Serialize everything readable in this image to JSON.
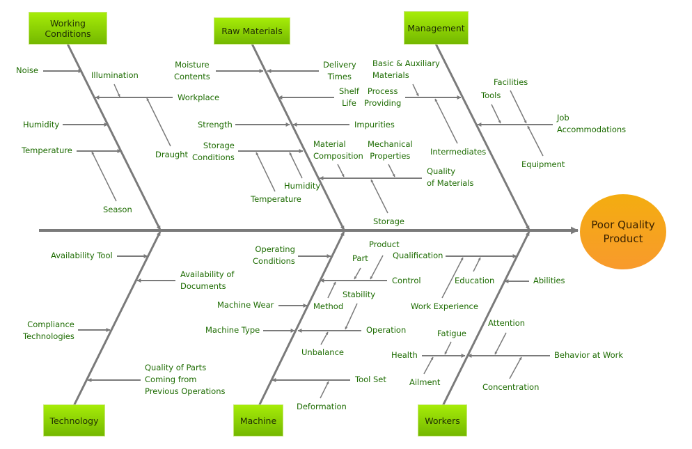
{
  "diagram": {
    "type": "fishbone",
    "effect": "Poor Quality\nProduct",
    "colors": {
      "bone": "#7a7a7a",
      "label_text": "#1c6b00",
      "category_fill_top": "#a6ec08",
      "category_fill_bottom": "#74b800",
      "effect_fill_top": "#f4ad10",
      "effect_fill_bottom": "#f89a2c"
    },
    "categories": {
      "working_conditions": {
        "title": "Working\nConditions",
        "causes": {
          "noise": "Noise",
          "illumination": "Illumination",
          "workplace": "Workplace",
          "humidity": "Humidity",
          "draught": "Draught",
          "temperature": "Temperature",
          "season": "Season"
        }
      },
      "raw_materials": {
        "title": "Raw Materials",
        "causes": {
          "moisture_contents": "Moisture\nContents",
          "delivery_times": "Delivery\nTimes",
          "shelf_life": "Shelf\nLife",
          "strength": "Strength",
          "impurities": "Impurities",
          "storage_conditions": "Storage\nConditions",
          "humidity": "Humidity",
          "temperature": "Temperature",
          "material_composition": "Material\nComposition",
          "mechanical_properties": "Mechanical\nProperties",
          "quality_of_materials": "Quality\nof Materials",
          "storage": "Storage"
        }
      },
      "management": {
        "title": "Management",
        "causes": {
          "basic_auxiliary_materials": "Basic & Auxiliary\nMaterials",
          "process_providing": "Process\nProviding",
          "intermediates": "Intermediates",
          "facilities": "Facilities",
          "tools": "Tools",
          "job_accommodations": "Job\nAccommodations",
          "equipment": "Equipment"
        }
      },
      "technology": {
        "title": "Technology",
        "causes": {
          "availability_tool": "Availability Tool",
          "availability_of_documents": "Availability of\nDocuments",
          "compliance_technologies": "Compliance\nTechnologies",
          "quality_of_parts": "Quality of Parts\nComing from\nPrevious Operations"
        }
      },
      "machine": {
        "title": "Machine",
        "causes": {
          "operating_conditions": "Operating\nConditions",
          "product": "Product",
          "part": "Part",
          "control": "Control",
          "stability": "Stability",
          "method": "Method",
          "machine_wear": "Machine Wear",
          "machine_type": "Machine Type",
          "operation": "Operation",
          "unbalance": "Unbalance",
          "tool_set": "Tool Set",
          "deformation": "Deformation"
        }
      },
      "workers": {
        "title": "Workers",
        "causes": {
          "qualification": "Qualification",
          "education": "Education",
          "work_experience": "Work Experience",
          "abilities": "Abilities",
          "attention": "Attention",
          "fatigue": "Fatigue",
          "health": "Health",
          "behavior_at_work": "Behavior at Work",
          "ailment": "Ailment",
          "concentration": "Concentration"
        }
      }
    }
  }
}
